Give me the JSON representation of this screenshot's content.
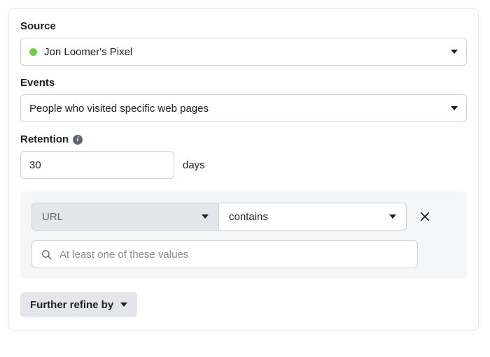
{
  "source": {
    "label": "Source",
    "value": "Jon Loomer's Pixel",
    "indicator_color": "#6fce44"
  },
  "events": {
    "label": "Events",
    "value": "People who visited specific web pages"
  },
  "retention": {
    "label": "Retention",
    "value": "30",
    "unit": "days"
  },
  "rule": {
    "field": "URL",
    "operator": "contains",
    "value_placeholder": "At least one of these values"
  },
  "refine": {
    "label": "Further refine by"
  }
}
